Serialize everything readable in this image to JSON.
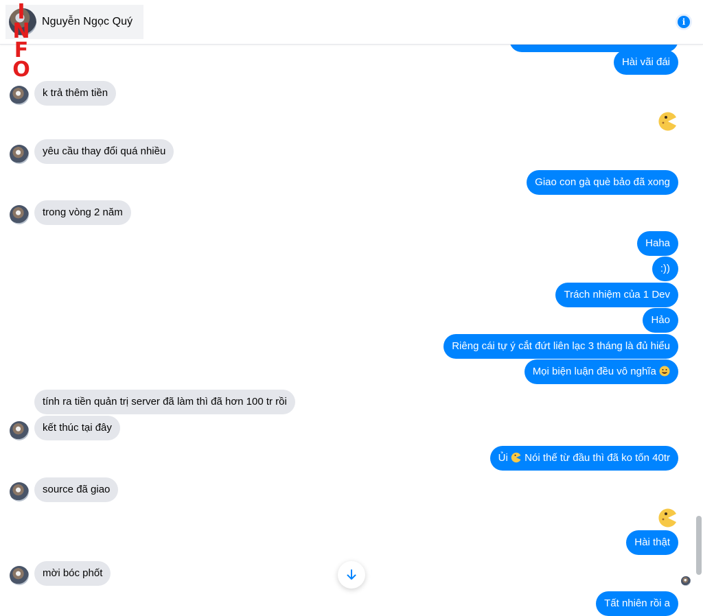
{
  "header": {
    "contact_name": "Nguyễn Ngọc Quý",
    "info_icon": "info-icon",
    "watermark": "INFO"
  },
  "messages": [
    {
      "direction": "out",
      "text": "Hài vãi đái"
    },
    {
      "direction": "in",
      "text": "k trả thêm tiền"
    },
    {
      "direction": "out",
      "emoji": "pacman-emoji"
    },
    {
      "direction": "in",
      "text": "yêu cầu thay đổi quá nhiều"
    },
    {
      "direction": "out",
      "text": "Giao con gà què bảo đã xong"
    },
    {
      "direction": "in",
      "text": "trong vòng 2 năm"
    },
    {
      "direction": "out",
      "text": "Haha"
    },
    {
      "direction": "out",
      "text": ":))"
    },
    {
      "direction": "out",
      "text": "Trách nhiệm của 1 Dev"
    },
    {
      "direction": "out",
      "text": "Hảo"
    },
    {
      "direction": "out",
      "text": "Riêng cái tự ý cắt đứt liên lạc 3 tháng là đủ hiểu"
    },
    {
      "direction": "out",
      "text": "Mọi biện luận đều vô nghĩa",
      "emoji": "smiley-emoji"
    },
    {
      "direction": "in",
      "text": "tính ra tiền quản trị server đã làm thì đã hơn 100 tr rồi"
    },
    {
      "direction": "in",
      "text": "kết thúc tại đây"
    },
    {
      "direction": "out",
      "text_before": "Ủi",
      "emoji": "pacman-emoji",
      "text_after": "Nói thế từ đầu thì đã ko tốn 40tr"
    },
    {
      "direction": "in",
      "text": "source đã giao"
    },
    {
      "direction": "out",
      "emoji": "pacman-emoji"
    },
    {
      "direction": "out",
      "text": "Hài thật"
    },
    {
      "direction": "in",
      "text": "mời bóc phốt"
    },
    {
      "direction": "out",
      "text": "Tất nhiên rồi a"
    }
  ],
  "controls": {
    "scroll_down_icon": "arrow-down-icon"
  },
  "colors": {
    "outgoing_bubble": "#0084ff",
    "incoming_bubble": "#e4e6eb",
    "watermark": "#e41d1d"
  }
}
